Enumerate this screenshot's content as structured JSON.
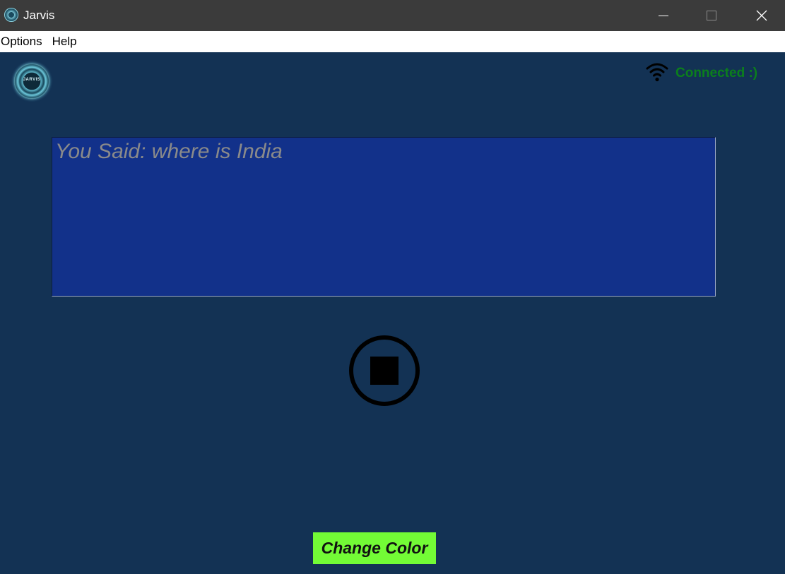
{
  "window": {
    "title": "Jarvis",
    "icons": {
      "app": "jarvis-app-icon",
      "minimize": "minimize-icon",
      "maximize": "maximize-icon",
      "close": "close-icon"
    }
  },
  "menu": {
    "items": [
      "Options",
      "Help"
    ]
  },
  "header": {
    "logo_icon": "jarvis-logo",
    "logo_text": "JARVIS",
    "wifi_icon": "wifi-icon",
    "status": "Connected :)",
    "status_color": "#0b7f1c"
  },
  "speech": {
    "text": "You Said: where is India"
  },
  "controls": {
    "stop_icon": "stop-icon",
    "change_color_label": "Change Color",
    "change_color_bg": "#73fb36"
  },
  "colors": {
    "background": "#133254",
    "speech_box_bg": "#12318a",
    "titlebar_bg": "#3b3b3b"
  }
}
